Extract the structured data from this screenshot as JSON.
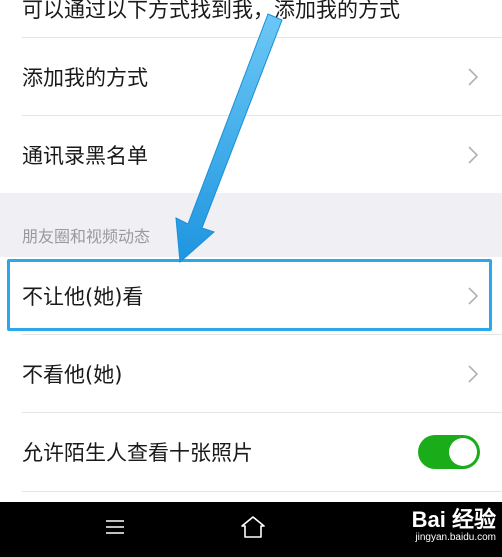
{
  "list": {
    "partial_top": "可以通过以下方式找到我，添加我的方式",
    "add_me": "添加我的方式",
    "blacklist": "通讯录黑名单"
  },
  "section": {
    "title": "朋友圈和视频动态"
  },
  "moments": {
    "dont_let_see": "不让他(她)看",
    "dont_see": "不看他(她)",
    "allow_strangers": "允许陌生人查看十张照片",
    "allow_strangers_on": true
  },
  "navbar": {
    "icons": [
      "menu-icon",
      "home-icon"
    ]
  },
  "watermark": {
    "brand": "Bai 经验",
    "url": "jingyan.baidu.com"
  },
  "colors": {
    "highlight": "#2aa8ea",
    "toggle_on": "#1aad19",
    "section_bg": "#efeff4"
  }
}
